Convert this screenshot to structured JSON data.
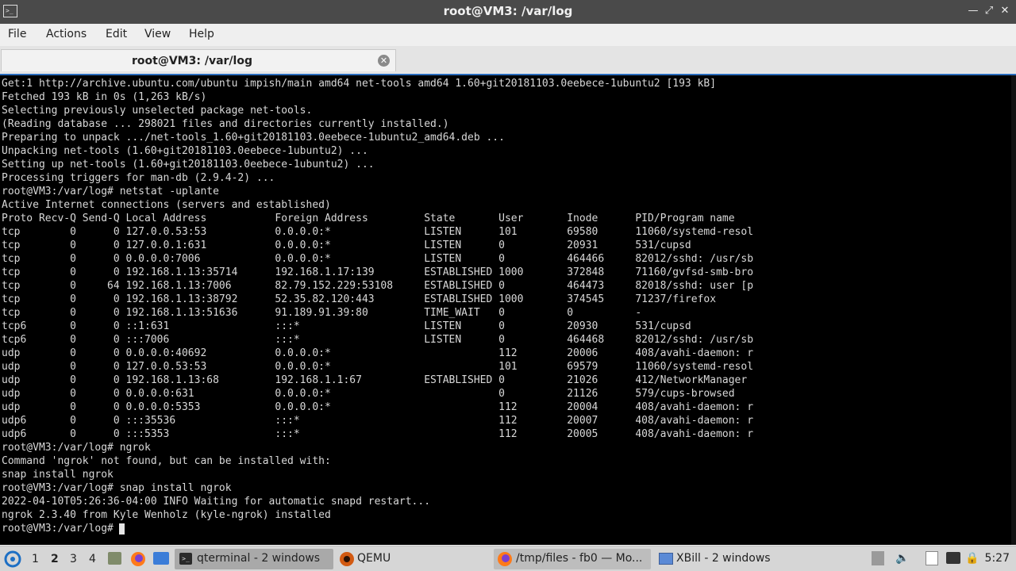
{
  "window": {
    "title": "root@VM3: /var/log",
    "icon": "terminal-icon"
  },
  "menu": [
    "File",
    "Actions",
    "Edit",
    "View",
    "Help"
  ],
  "tab": {
    "label": "root@VM3: /var/log"
  },
  "terminal": {
    "lines": [
      "Get:1 http://archive.ubuntu.com/ubuntu impish/main amd64 net-tools amd64 1.60+git20181103.0eebece-1ubuntu2 [193 kB]",
      "Fetched 193 kB in 0s (1,263 kB/s)",
      "Selecting previously unselected package net-tools.",
      "(Reading database ... 298021 files and directories currently installed.)",
      "Preparing to unpack .../net-tools_1.60+git20181103.0eebece-1ubuntu2_amd64.deb ...",
      "Unpacking net-tools (1.60+git20181103.0eebece-1ubuntu2) ...",
      "Setting up net-tools (1.60+git20181103.0eebece-1ubuntu2) ...",
      "Processing triggers for man-db (2.9.4-2) ...",
      "root@VM3:/var/log# netstat -uplante",
      "Active Internet connections (servers and established)",
      "Proto Recv-Q Send-Q Local Address           Foreign Address         State       User       Inode      PID/Program name",
      "tcp        0      0 127.0.0.53:53           0.0.0.0:*               LISTEN      101        69580      11060/systemd-resol",
      "tcp        0      0 127.0.0.1:631           0.0.0.0:*               LISTEN      0          20931      531/cupsd",
      "tcp        0      0 0.0.0.0:7006            0.0.0.0:*               LISTEN      0          464466     82012/sshd: /usr/sb",
      "tcp        0      0 192.168.1.13:35714      192.168.1.17:139        ESTABLISHED 1000       372848     71160/gvfsd-smb-bro",
      "tcp        0     64 192.168.1.13:7006       82.79.152.229:53108     ESTABLISHED 0          464473     82018/sshd: user [p",
      "tcp        0      0 192.168.1.13:38792      52.35.82.120:443        ESTABLISHED 1000       374545     71237/firefox",
      "tcp        0      0 192.168.1.13:51636      91.189.91.39:80         TIME_WAIT   0          0          -",
      "tcp6       0      0 ::1:631                 :::*                    LISTEN      0          20930      531/cupsd",
      "tcp6       0      0 :::7006                 :::*                    LISTEN      0          464468     82012/sshd: /usr/sb",
      "udp        0      0 0.0.0.0:40692           0.0.0.0:*                           112        20006      408/avahi-daemon: r",
      "udp        0      0 127.0.0.53:53           0.0.0.0:*                           101        69579      11060/systemd-resol",
      "udp        0      0 192.168.1.13:68         192.168.1.1:67          ESTABLISHED 0          21026      412/NetworkManager",
      "udp        0      0 0.0.0.0:631             0.0.0.0:*                           0          21126      579/cups-browsed",
      "udp        0      0 0.0.0.0:5353            0.0.0.0:*                           112        20004      408/avahi-daemon: r",
      "udp6       0      0 :::35536                :::*                                112        20007      408/avahi-daemon: r",
      "udp6       0      0 :::5353                 :::*                                112        20005      408/avahi-daemon: r",
      "root@VM3:/var/log# ngrok",
      "Command 'ngrok' not found, but can be installed with:",
      "snap install ngrok",
      "root@VM3:/var/log# snap install ngrok",
      "2022-04-10T05:26:36-04:00 INFO Waiting for automatic snapd restart...",
      "ngrok 2.3.40 from Kyle Wenholz (kyle-ngrok) installed",
      "root@VM3:/var/log# "
    ]
  },
  "taskbar": {
    "workspaces": [
      "1",
      "2",
      "3",
      "4"
    ],
    "active_workspace": "2",
    "tasks": [
      {
        "label": "qterminal - 2 windows",
        "icon": "terminal-icon"
      },
      {
        "label": "QEMU",
        "icon": "qemu-icon"
      },
      {
        "label": "/tmp/files - fb0 — Mo...",
        "icon": "firefox-icon"
      },
      {
        "label": "XBill - 2 windows",
        "icon": "window-icon"
      }
    ],
    "clock": "5:27"
  }
}
